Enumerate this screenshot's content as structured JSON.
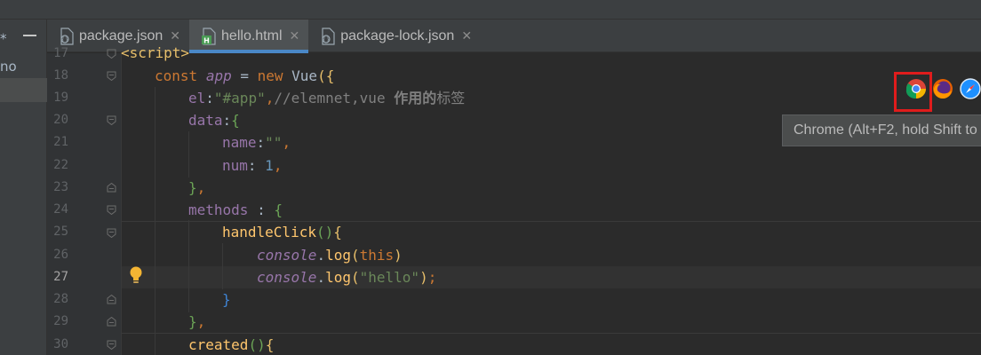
{
  "project_panel": {
    "partial_label": "no"
  },
  "tabs": [
    {
      "label": "package.json",
      "icon": "json-file-icon",
      "active": false
    },
    {
      "label": "hello.html",
      "icon": "html-file-icon",
      "active": true
    },
    {
      "label": "package-lock.json",
      "icon": "json-file-icon",
      "active": false
    }
  ],
  "editor": {
    "current_line": 27,
    "line_numbers": [
      "17",
      "18",
      "19",
      "20",
      "21",
      "22",
      "23",
      "24",
      "25",
      "26",
      "27",
      "28",
      "29",
      "30"
    ],
    "lines": {
      "l17": {
        "tag": "<script>"
      },
      "l18": {
        "kw1": "const",
        "var": "app",
        "eq": " = ",
        "kw2": "new",
        "fn": " Vue",
        "br": "({"
      },
      "l19": {
        "prop": "el",
        "colon": ":",
        "str": "\"#app\"",
        "comma": ",",
        "cmt": "//elemnet,vue ",
        "cmt_bold": "作用的",
        "cmt_tail": "标签"
      },
      "l20": {
        "prop": "data",
        "colon": ":",
        "br": "{"
      },
      "l21": {
        "prop": "name",
        "colon": ":",
        "str": "\"\"",
        "comma": ","
      },
      "l22": {
        "prop": "num",
        "colon": ": ",
        "num": "1",
        "comma": ","
      },
      "l23": {
        "br": "}",
        "comma": ","
      },
      "l24": {
        "prop": "methods",
        "colon": " : ",
        "br": "{"
      },
      "l25": {
        "fn": "handleClick",
        "paren": "()",
        "br": "{"
      },
      "l26": {
        "console": "console",
        "dot": ".",
        "fn": "log",
        "p1": "(",
        "this": "this",
        "p2": ")"
      },
      "l27": {
        "console": "console",
        "dot": ".",
        "fn": "log",
        "p1": "(",
        "str": "\"hello\"",
        "p2": ")",
        "semi": ";"
      },
      "l28": {
        "br": "}"
      },
      "l29": {
        "br": "}",
        "comma": ","
      },
      "l30": {
        "fn": "created",
        "paren": "()",
        "br": "{"
      }
    }
  },
  "browser_icons": [
    "chrome-icon",
    "firefox-icon",
    "safari-icon"
  ],
  "tooltip": {
    "text": "Chrome (Alt+F2, hold Shift to"
  },
  "colors": {
    "highlight": "#e01c1c",
    "active_tab_underline": "#4a88c7"
  }
}
